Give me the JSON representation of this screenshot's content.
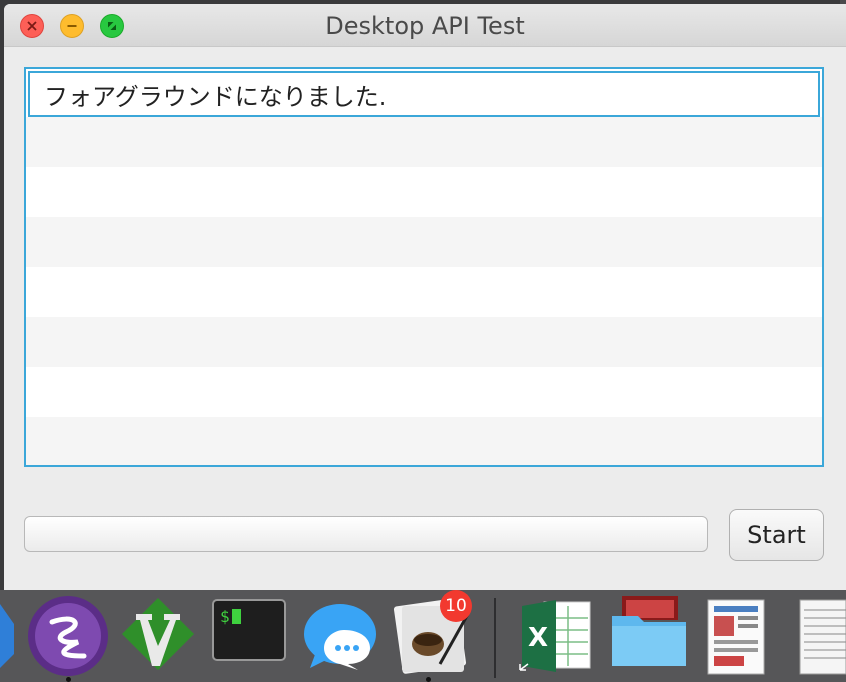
{
  "window": {
    "title": "Desktop API Test"
  },
  "log_list": {
    "items": [
      "フォアグラウンドになりました."
    ]
  },
  "controls": {
    "input_value": "",
    "start_label": "Start"
  },
  "dock": {
    "apps": [
      {
        "name": "app-partial-icon"
      },
      {
        "name": "emacs-icon"
      },
      {
        "name": "vim-icon"
      },
      {
        "name": "terminal-icon"
      },
      {
        "name": "messages-icon"
      },
      {
        "name": "script-editor-icon"
      },
      {
        "name": "excel-icon"
      },
      {
        "name": "folder-icon"
      },
      {
        "name": "document-stack-icon"
      },
      {
        "name": "document-partial-icon"
      }
    ],
    "badge_count": "10"
  },
  "colors": {
    "accent": "#3ba7d9",
    "close": "#fd5f57",
    "minimize": "#febc2e",
    "maximize": "#28c840"
  }
}
